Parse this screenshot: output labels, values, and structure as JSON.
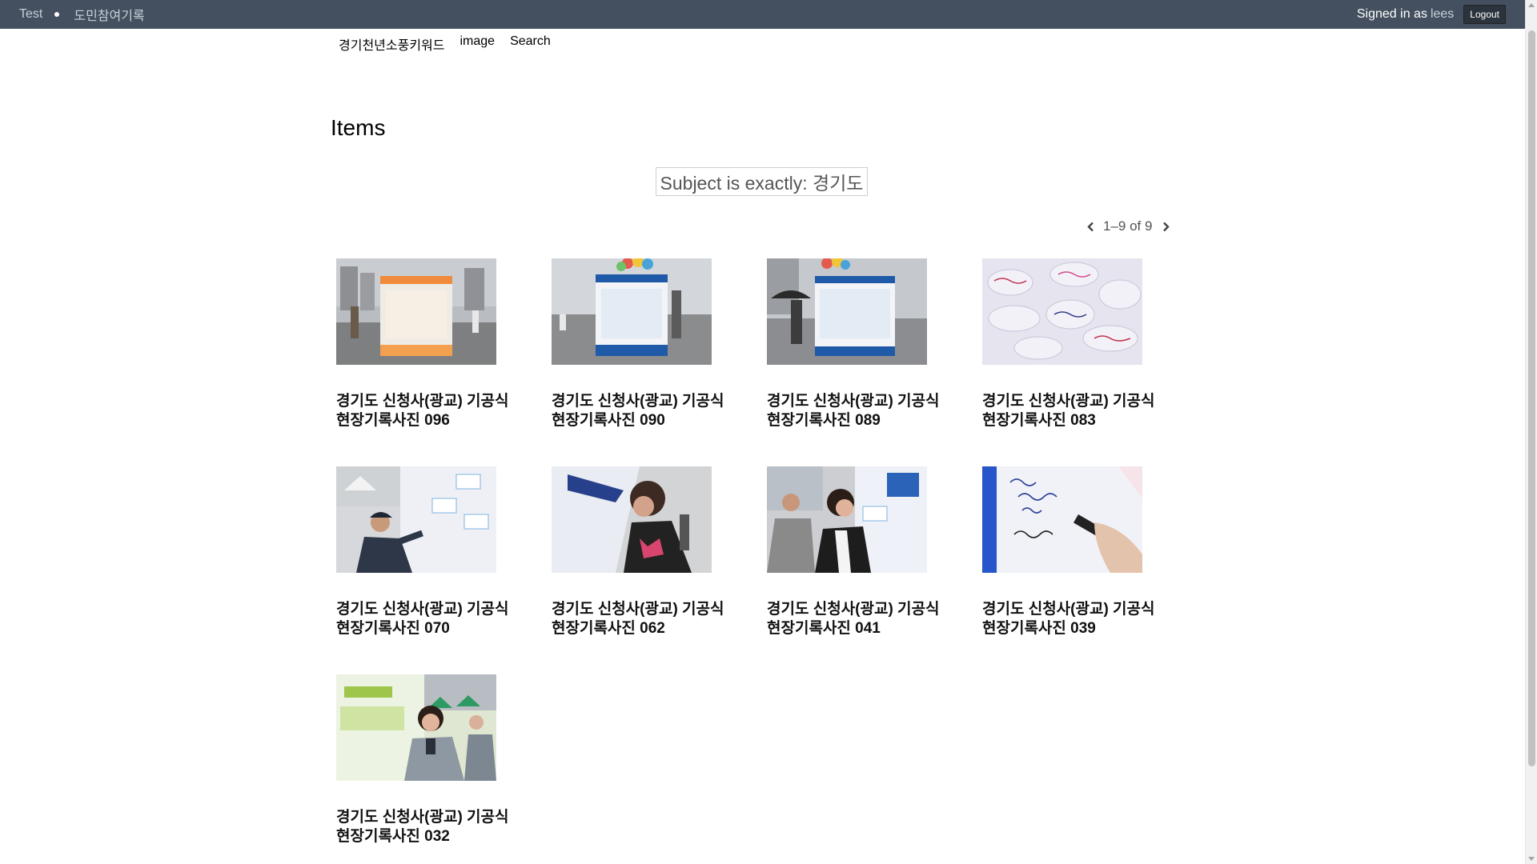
{
  "admin_bar": {
    "site_name": "Test",
    "site_title": "도민참여기록",
    "signed_in_label": "Signed in as",
    "username": "lees",
    "logout_label": "Logout"
  },
  "nav": {
    "items": [
      "경기천년소풍키워드",
      "image",
      "Search"
    ]
  },
  "page": {
    "title": "Items",
    "filter": "Subject is exactly: 경기도"
  },
  "pagination": {
    "text": "1–9 of 9"
  },
  "items": [
    {
      "title": "경기도 신청사(광교) 기공식 현장기록사진 096"
    },
    {
      "title": "경기도 신청사(광교) 기공식 현장기록사진 090"
    },
    {
      "title": "경기도 신청사(광교) 기공식 현장기록사진 089"
    },
    {
      "title": "경기도 신청사(광교) 기공식 현장기록사진 083"
    },
    {
      "title": "경기도 신청사(광교) 기공식 현장기록사진 070"
    },
    {
      "title": "경기도 신청사(광교) 기공식 현장기록사진 062"
    },
    {
      "title": "경기도 신청사(광교) 기공식 현장기록사진 041"
    },
    {
      "title": "경기도 신청사(광교) 기공식 현장기록사진 039"
    },
    {
      "title": "경기도 신청사(광교) 기공식 현장기록사진 032"
    }
  ]
}
